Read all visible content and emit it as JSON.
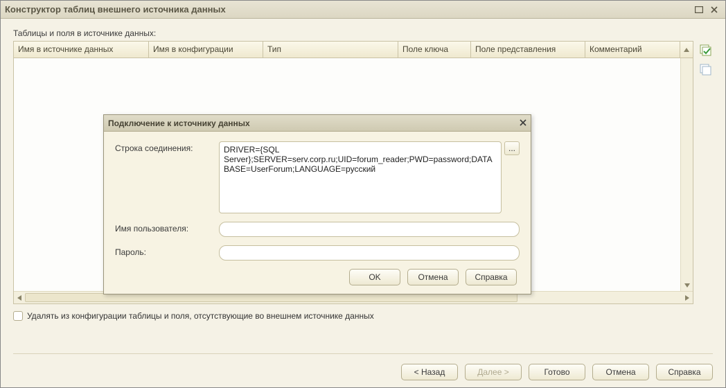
{
  "window": {
    "title": "Конструктор таблиц внешнего источника данных"
  },
  "section_label": "Таблицы и поля в источнике данных:",
  "columns": {
    "source_name": "Имя в источнике данных",
    "config_name": "Имя в конфигурации",
    "type": "Тип",
    "key_field": "Поле ключа",
    "presentation_field": "Поле представления",
    "comment": "Комментарий"
  },
  "checkbox_label": "Удалять из конфигурации таблицы и поля, отсутствующие во внешнем источнике данных",
  "footer": {
    "back": "< Назад",
    "next": "Далее >",
    "finish": "Готово",
    "cancel": "Отмена",
    "help": "Справка"
  },
  "dialog": {
    "title": "Подключение к источнику данных",
    "conn_label": "Строка соединения:",
    "conn_value": "DRIVER={SQL Server};SERVER=serv.corp.ru;UID=forum_reader;PWD=password;DATABASE=UserForum;LANGUAGE=русский",
    "user_label": "Имя пользователя:",
    "user_value": "",
    "pass_label": "Пароль:",
    "pass_value": "",
    "ok": "OK",
    "cancel": "Отмена",
    "help": "Справка",
    "ellipsis": "..."
  }
}
